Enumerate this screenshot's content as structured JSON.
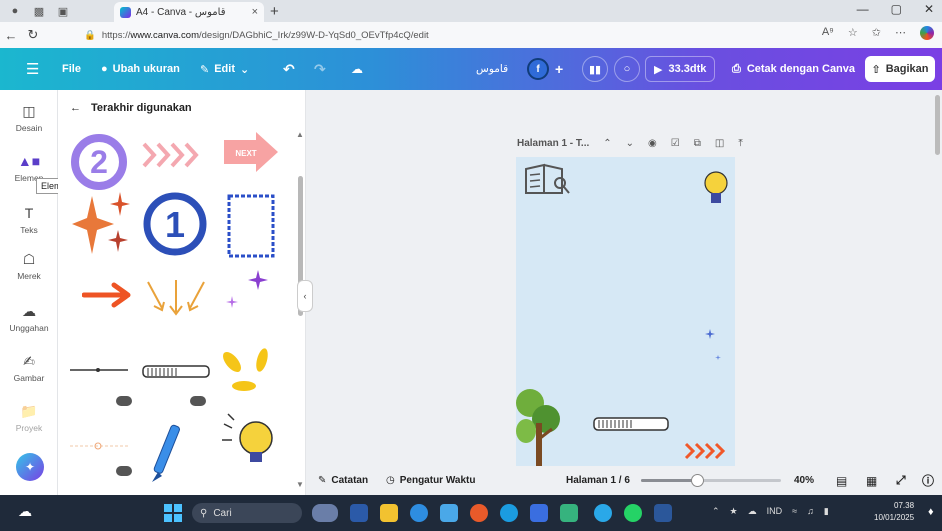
{
  "browser": {
    "tab_title": "A4 - Canva - قاموس",
    "tab_close": "×",
    "new_tab": "+",
    "url_prefix": "https://",
    "url_host": "www.canva.com",
    "url_path": "/design/DAGbhiC_Irk/z99W-D-YqSd0_OEvTfp4cQ/edit",
    "win_min": "—",
    "win_max": "▢",
    "win_close": "✕"
  },
  "toolbar": {
    "file": "File",
    "resize": "Ubah ukuran",
    "edit": "Edit",
    "design_title": "قاموس",
    "avatar_initial": "f",
    "play_label": "33.3dtk",
    "print_label": "Cetak dengan Canva",
    "share_label": "Bagikan"
  },
  "rail": {
    "items": [
      {
        "label": "Desain",
        "icon": "layout-icon"
      },
      {
        "label": "Elemen",
        "icon": "shapes-icon"
      },
      {
        "label": "Teks",
        "icon": "text-icon"
      },
      {
        "label": "Merek",
        "icon": "brand-icon"
      },
      {
        "label": "Unggahan",
        "icon": "upload-icon"
      },
      {
        "label": "Gambar",
        "icon": "draw-icon"
      },
      {
        "label": "Proyek",
        "icon": "folder-icon"
      }
    ],
    "tooltip": "Elemen"
  },
  "panel": {
    "title": "Terakhir digunakan",
    "next_sticker": "NEXT"
  },
  "canvas": {
    "page_title": "Halaman 1 - T...",
    "background_color": "#d6e8f5"
  },
  "footer": {
    "notes": "Catatan",
    "timer": "Pengatur Waktu",
    "page_indicator": "Halaman 1 / 6",
    "zoom": "40%",
    "zoom_fraction": 0.4
  },
  "taskbar": {
    "search_placeholder": "Cari",
    "lang": "IND",
    "time": "07.38",
    "date": "10/01/2025"
  },
  "colors": {
    "accent_purple": "#7a3fe4",
    "accent_cyan": "#1bb7cf",
    "sticker_pink": "#f7a8a8",
    "sticker_blue": "#2b4fc8",
    "sticker_orange": "#f0582a",
    "sticker_yellow": "#f5c518"
  }
}
